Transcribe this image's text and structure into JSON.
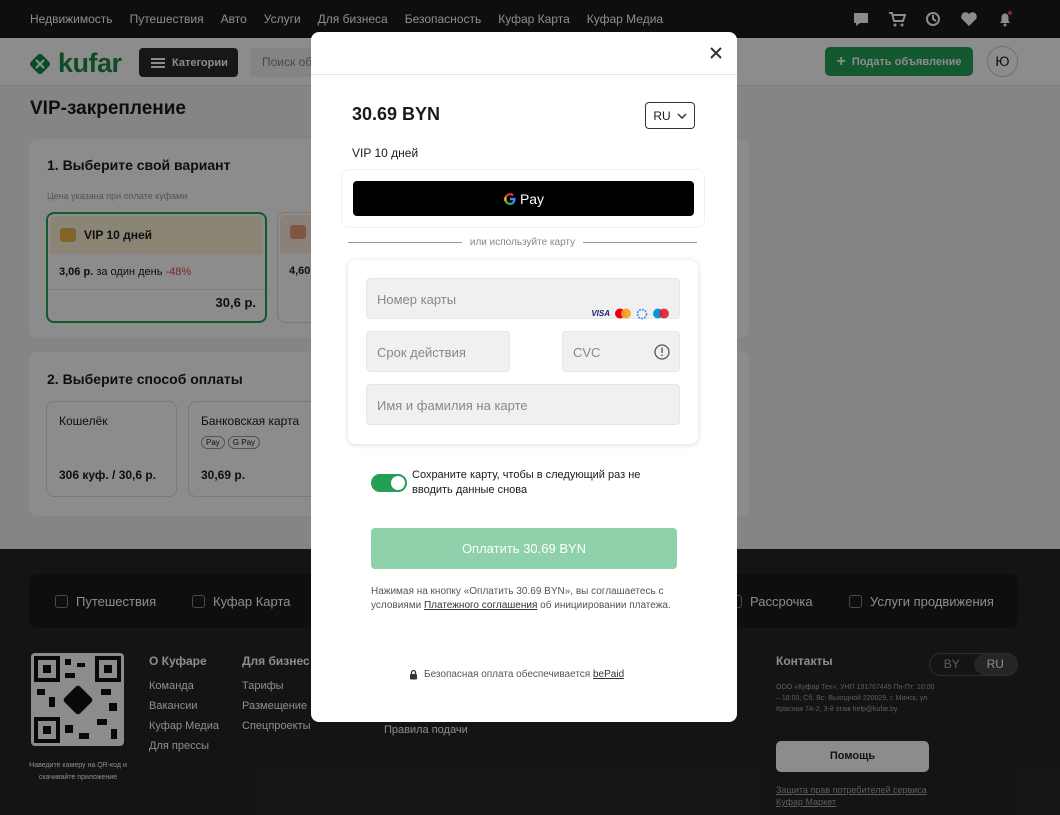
{
  "topbar": {
    "nav": [
      "Недвижимость",
      "Путешествия",
      "Авто",
      "Услуги",
      "Для бизнеса",
      "Безопасность",
      "Куфар Карта",
      "Куфар Медиа"
    ],
    "icons": [
      "chat-icon",
      "cart-icon",
      "history-icon",
      "heart-icon",
      "bell-icon"
    ]
  },
  "header": {
    "logo": "kufar",
    "categories_label": "Категории",
    "search_placeholder": "Поиск объявлений",
    "post_label": "Подать объявление",
    "avatar_letter": "Ю",
    "accent": "#23a055"
  },
  "page": {
    "title": "VIP-закрепление",
    "step1": {
      "title": "1. Выберите свой вариант",
      "note": "Цена указана при оплате куфами",
      "option1": {
        "name": "VIP 10 дней",
        "per_day": "3,06 р.",
        "per_day_suffix": "за один день",
        "discount": "-48%",
        "total": "30,6 р."
      },
      "option2": {
        "per_day": "4,60"
      }
    },
    "step2": {
      "title": "2. Выберите способ оплаты",
      "wallet": {
        "label": "Кошелёк",
        "value": "306 куф. / 30,6 р."
      },
      "bank": {
        "label": "Банковская карта",
        "badges": [
          "Pay",
          "G Pay"
        ],
        "value": "30,69 р."
      }
    }
  },
  "footer": {
    "nav": [
      "Путешествия",
      "Куфар Карта",
      "Рассрочка",
      "Услуги продвижения"
    ],
    "qr_text": "Наведите камеру на QR-код и скачивайте приложение",
    "col1": {
      "title": "О Куфаре",
      "links": [
        "Команда",
        "Вакансии",
        "Куфар Медиа",
        "Для прессы"
      ]
    },
    "col2": {
      "title": "Для бизнес",
      "links": [
        "Тарифы",
        "Размещение",
        "Спецпроекты"
      ]
    },
    "col3": {
      "links": [
        "Правила подачи"
      ]
    },
    "contacts": {
      "title": "Контакты",
      "text": "ООО «Куфар Тех», УНП 191767445 Пн-Пт: 10:00 – 18:00; Сб, Вс: Выходной 220029, г. Минск, ул. Красная 7А-2, 3-й этаж help@kufar.by",
      "help_label": "Помощь",
      "protect_link": "Защита прав потребителей сервиса Куфар Маркет"
    },
    "lang": {
      "by": "BY",
      "ru": "RU"
    }
  },
  "modal": {
    "amount": "30.69 BYN",
    "lang": "RU",
    "description": "VIP 10 дней",
    "gpay_label": "Pay",
    "or_text": "или используйте карту",
    "card_number_placeholder": "Номер карты",
    "card_brands": [
      "VISA",
      "mastercard",
      "belkart",
      "maestro"
    ],
    "expiry_placeholder": "Срок действия",
    "cvc_placeholder": "CVC",
    "name_placeholder": "Имя и фамилия на карте",
    "save_card_text": "Сохраните карту, чтобы в следующий раз не вводить данные снова",
    "save_card_enabled": true,
    "pay_label": "Оплатить 30.69 BYN",
    "terms_prefix": "Нажимая на кнопку «Оплатить 30.69 BYN», вы соглашаетесь с условиями",
    "terms_link": "Платежного соглашения",
    "terms_suffix": "об инициировании платежа.",
    "secure_text": "Безопасная оплата обеспечивается",
    "secure_link": "bePaid"
  }
}
